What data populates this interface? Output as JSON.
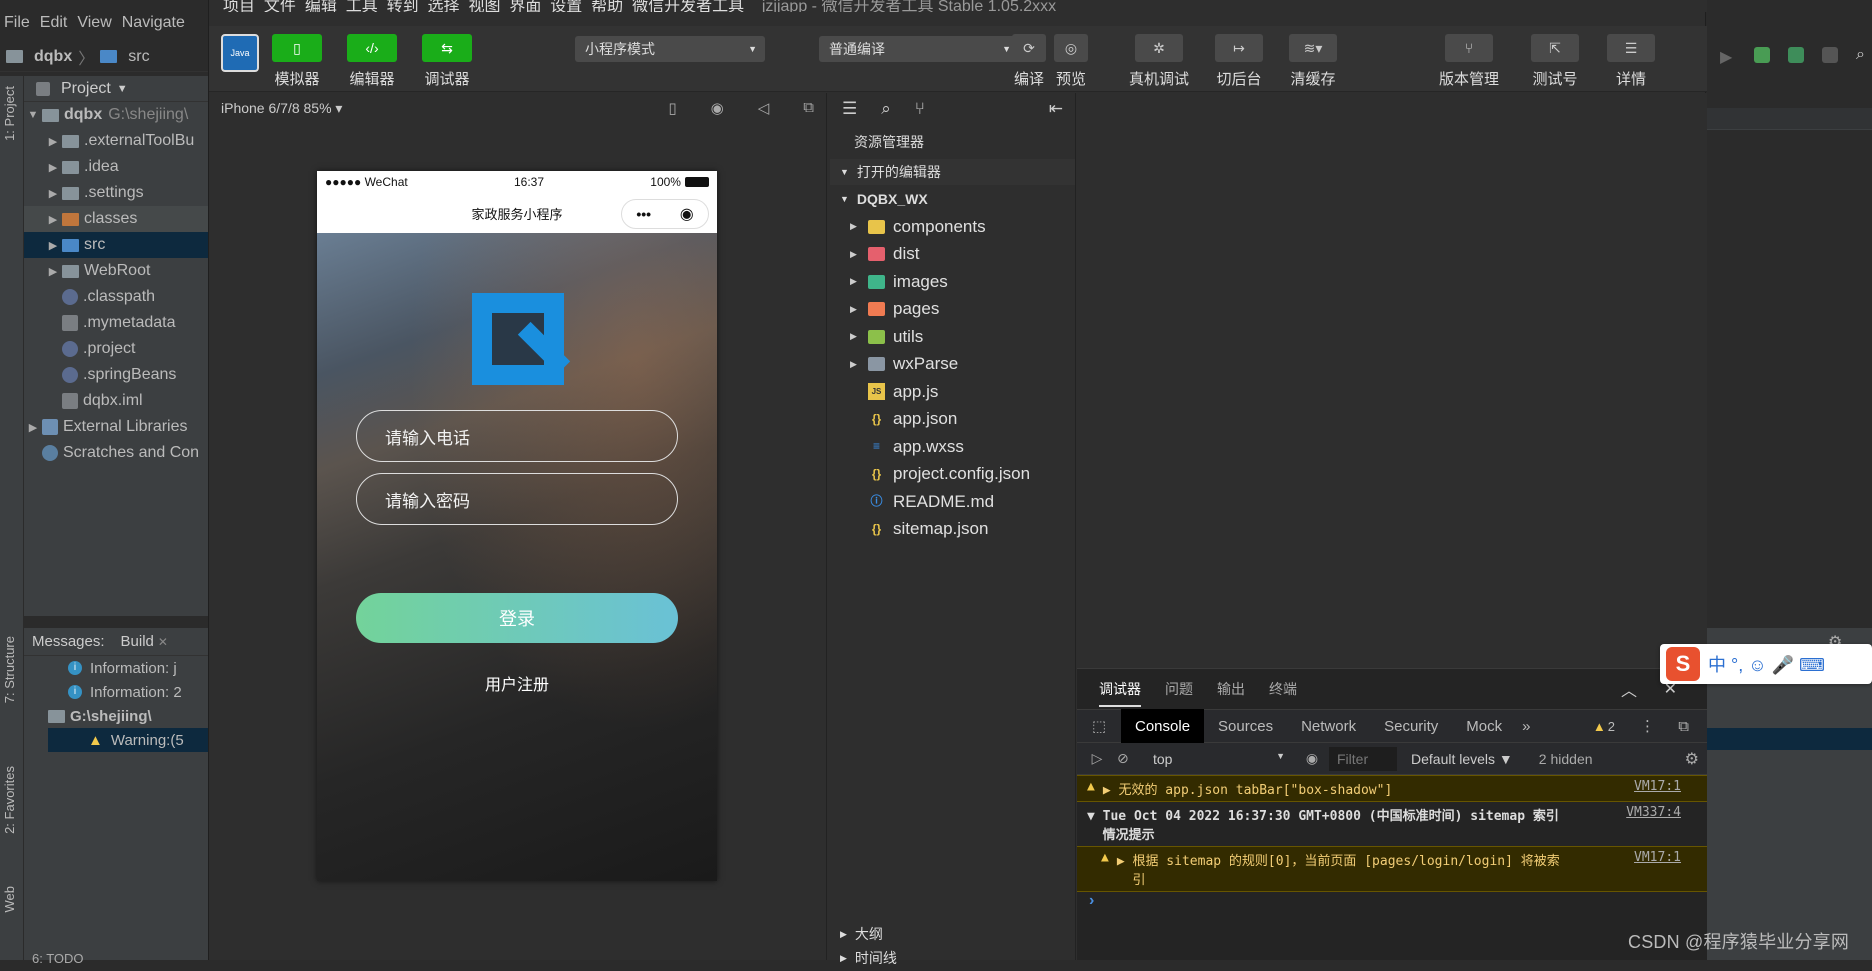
{
  "idea": {
    "menu": [
      "File",
      "Edit",
      "View",
      "Navigate"
    ],
    "breadcrumb": [
      "dqbx",
      "src"
    ],
    "left_tabs": [
      "1: Project",
      "7: Structure",
      "2: Favorites",
      "Web"
    ],
    "project_header": "Project",
    "tree": [
      {
        "label": "dqbx",
        "extra": "G:\\shejiing\\",
        "arrow": "▼",
        "indent": 0,
        "icon": "folder"
      },
      {
        "label": ".externalToolBu",
        "arrow": "▶",
        "indent": 1,
        "icon": "folder"
      },
      {
        "label": ".idea",
        "arrow": "▶",
        "indent": 1,
        "icon": "folder"
      },
      {
        "label": ".settings",
        "arrow": "▶",
        "indent": 1,
        "icon": "folder"
      },
      {
        "label": "classes",
        "arrow": "▶",
        "indent": 1,
        "icon": "folder-orange"
      },
      {
        "label": "src",
        "arrow": "▶",
        "indent": 1,
        "icon": "folder-blue"
      },
      {
        "label": "WebRoot",
        "arrow": "▶",
        "indent": 1,
        "icon": "folder"
      },
      {
        "label": ".classpath",
        "arrow": "",
        "indent": 1,
        "icon": "file"
      },
      {
        "label": ".mymetadata",
        "arrow": "",
        "indent": 1,
        "icon": "file-sq"
      },
      {
        "label": ".project",
        "arrow": "",
        "indent": 1,
        "icon": "file"
      },
      {
        "label": ".springBeans",
        "arrow": "",
        "indent": 1,
        "icon": "file"
      },
      {
        "label": "dqbx.iml",
        "arrow": "",
        "indent": 1,
        "icon": "file-sq"
      },
      {
        "label": "External Libraries",
        "arrow": "▶",
        "indent": 0,
        "icon": "lib"
      },
      {
        "label": "Scratches and Con",
        "arrow": "",
        "indent": 0,
        "icon": "scratch"
      }
    ],
    "messages_tabs": [
      "Messages:",
      "Build"
    ],
    "messages": [
      {
        "icon": "info",
        "text": "Information: j"
      },
      {
        "icon": "info",
        "text": "Information: 2"
      },
      {
        "icon": "folder",
        "text": "G:\\shejiing\\"
      },
      {
        "icon": "warn",
        "text": "Warning:(5"
      }
    ],
    "bottom_tabs": [
      "6: TODO"
    ]
  },
  "wx": {
    "title": "jzjjapp - 微信开发者工具 Stable 1.05.2xxx",
    "menu": [
      "项目",
      "文件",
      "编辑",
      "工具",
      "转到",
      "选择",
      "视图",
      "界面",
      "设置",
      "帮助",
      "微信开发者工具"
    ],
    "toolbar": {
      "avatar_text": "Java",
      "simulator": "模拟器",
      "editor": "编辑器",
      "debugger": "调试器",
      "mode": "小程序模式",
      "compile_mode": "普通编译",
      "compile": "编译",
      "preview": "预览",
      "real_debug": "真机调试",
      "background": "切后台",
      "clear_cache": "清缓存",
      "version": "版本管理",
      "test_no": "测试号",
      "details": "详情"
    },
    "simulator": {
      "device": "iPhone 6/7/8 85% ▾",
      "status_left": "●●●●● WeChat",
      "status_time": "16:37",
      "status_battery": "100%",
      "nav_title": "家政服务小程序",
      "capsule_more": "•••",
      "capsule_close": "◉",
      "phone_placeholder": "请输入电话",
      "password_placeholder": "请输入密码",
      "login": "登录",
      "register": "用户注册"
    },
    "explorer": {
      "title": "资源管理器",
      "open_editors": "打开的编辑器",
      "project": "DQBX_WX",
      "items": [
        {
          "label": "components",
          "type": "folder",
          "color": "#e8c44a"
        },
        {
          "label": "dist",
          "type": "folder",
          "color": "#e5606d"
        },
        {
          "label": "images",
          "type": "folder",
          "color": "#3fb58a"
        },
        {
          "label": "pages",
          "type": "folder",
          "color": "#f07b52"
        },
        {
          "label": "utils",
          "type": "folder",
          "color": "#8cc04a"
        },
        {
          "label": "wxParse",
          "type": "folder",
          "color": "#8a96a3"
        },
        {
          "label": "app.js",
          "type": "js",
          "color": "#e8c44a"
        },
        {
          "label": "app.json",
          "type": "json",
          "color": "#e8c44a"
        },
        {
          "label": "app.wxss",
          "type": "css",
          "color": "#3a8ee6"
        },
        {
          "label": "project.config.json",
          "type": "json",
          "color": "#e8c44a"
        },
        {
          "label": "README.md",
          "type": "info",
          "color": "#3a8ee6"
        },
        {
          "label": "sitemap.json",
          "type": "json",
          "color": "#e8c44a"
        }
      ],
      "outline": "大纲",
      "timeline": "时间线"
    },
    "devtools": {
      "top_tabs": [
        "调试器",
        "问题",
        "输出",
        "终端"
      ],
      "tabs": [
        "Console",
        "Sources",
        "Network",
        "Security",
        "Mock"
      ],
      "warn_count": "2",
      "context": "top",
      "filter_placeholder": "Filter",
      "levels": "Default levels ▼",
      "hidden": "2 hidden",
      "console": [
        {
          "type": "warn",
          "text": "▶ 无效的 app.json tabBar[\"box-shadow\"]",
          "link": "VM17:1"
        },
        {
          "type": "group",
          "text": "▼ Tue Oct 04 2022 16:37:30 GMT+0800 (中国标准时间) sitemap 索引\n  情况提示",
          "link": "VM337:4"
        },
        {
          "type": "warn",
          "text": "▶ 根据 sitemap 的规则[0]，当前页面 [pages/login/login] 将被索\n  引",
          "link": "VM17:1"
        }
      ],
      "prompt": "›"
    }
  },
  "watermark": "CSDN @程序猿毕业分享网",
  "ime": {
    "text": "中 °, ☺ 🎤 ⌨"
  }
}
